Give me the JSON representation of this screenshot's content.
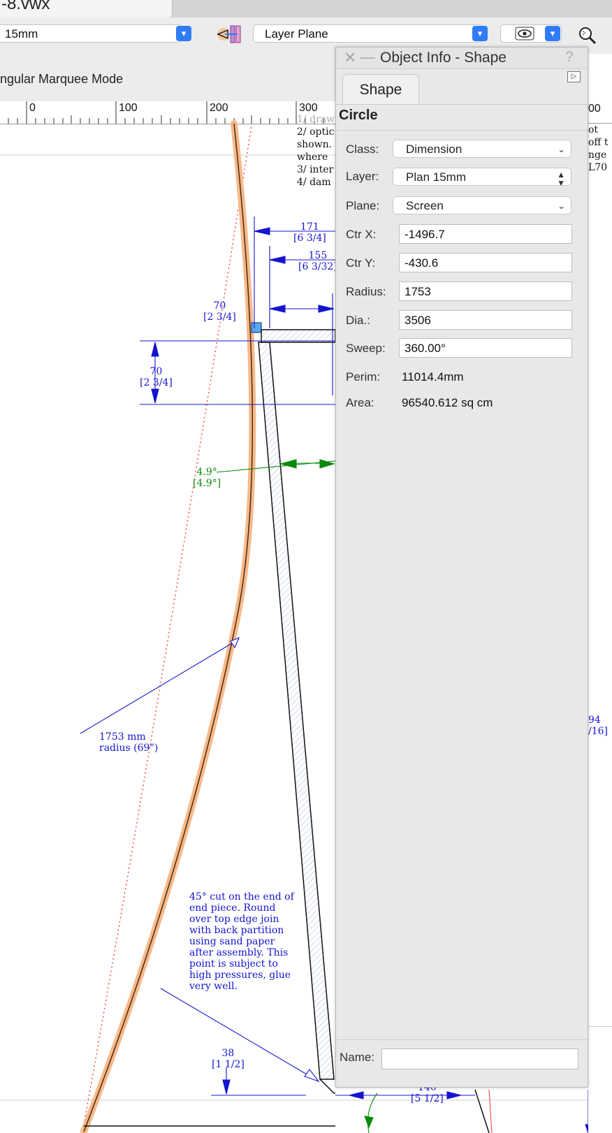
{
  "window": {
    "doc_title": "-8.vwx"
  },
  "toolbar": {
    "layer_combo_value": "15mm",
    "plane_combo_value": "Layer Plane",
    "chevron_glyph": "▾"
  },
  "mode_bar": {
    "mode_text": "ngular Marquee Mode"
  },
  "ruler": {
    "labels": [
      "0",
      "100",
      "200",
      "300"
    ],
    "right_label": "00"
  },
  "drawing": {
    "notes_top": [
      "1/ draw",
      "2/ optic",
      "shown.",
      "where",
      "3/ inter",
      "4/ dam"
    ],
    "notes_right": [
      "ot",
      "off t",
      "nge",
      "L70"
    ],
    "dim_171": "171",
    "dim_171_in": "[6 3/4]",
    "dim_155": "155",
    "dim_155_in": "[6 3/32]",
    "dim_70a": "70",
    "dim_70a_in": "[2 3/4]",
    "dim_70b": "70",
    "dim_70b_in": "[2 3/4]",
    "angle_val": "4.9°",
    "angle_in": "[4.9°]",
    "radius_line1": "1753 mm",
    "radius_line2": "radius (69\")",
    "cut_note": [
      "45° cut on the end of",
      "end piece. Round",
      "over top edge join",
      "with back partition",
      "using sand paper",
      "after assembly. This",
      "point is subject to",
      "high pressures, glue",
      "very well."
    ],
    "dim_38": "38",
    "dim_38_in": "[1 1/2]",
    "dim_140": "140",
    "dim_140_in": "[5 1/2]",
    "dim_right_a": "94",
    "dim_right_b": "/16]"
  },
  "palette": {
    "title": "Object Info - Shape",
    "close_glyph": "✕",
    "min_glyph": "—",
    "help_glyph": "?",
    "arrow_glyph": "▷",
    "tab_label": "Shape",
    "shape_type": "Circle",
    "class_label": "Class:",
    "class_value": "Dimension",
    "layer_label": "Layer:",
    "layer_value": "Plan 15mm",
    "plane_label": "Plane:",
    "plane_value": "Screen",
    "ctrx_label": "Ctr X:",
    "ctrx_value": "-1496.7",
    "ctry_label": "Ctr Y:",
    "ctry_value": "-430.6",
    "radius_label": "Radius:",
    "radius_value": "1753",
    "dia_label": "Dia.:",
    "dia_value": "3506",
    "sweep_label": "Sweep:",
    "sweep_value": "360.00°",
    "perim_label": "Perim:",
    "perim_value": "11014.4mm",
    "area_label": "Area:",
    "area_value": "96540.612 sq cm",
    "name_label": "Name:",
    "name_value": ""
  },
  "colors": {
    "accent": "#2f7cf6",
    "dimension": "#1414d0",
    "angle": "#0a8a0a",
    "highlight": "#f7b98a"
  }
}
